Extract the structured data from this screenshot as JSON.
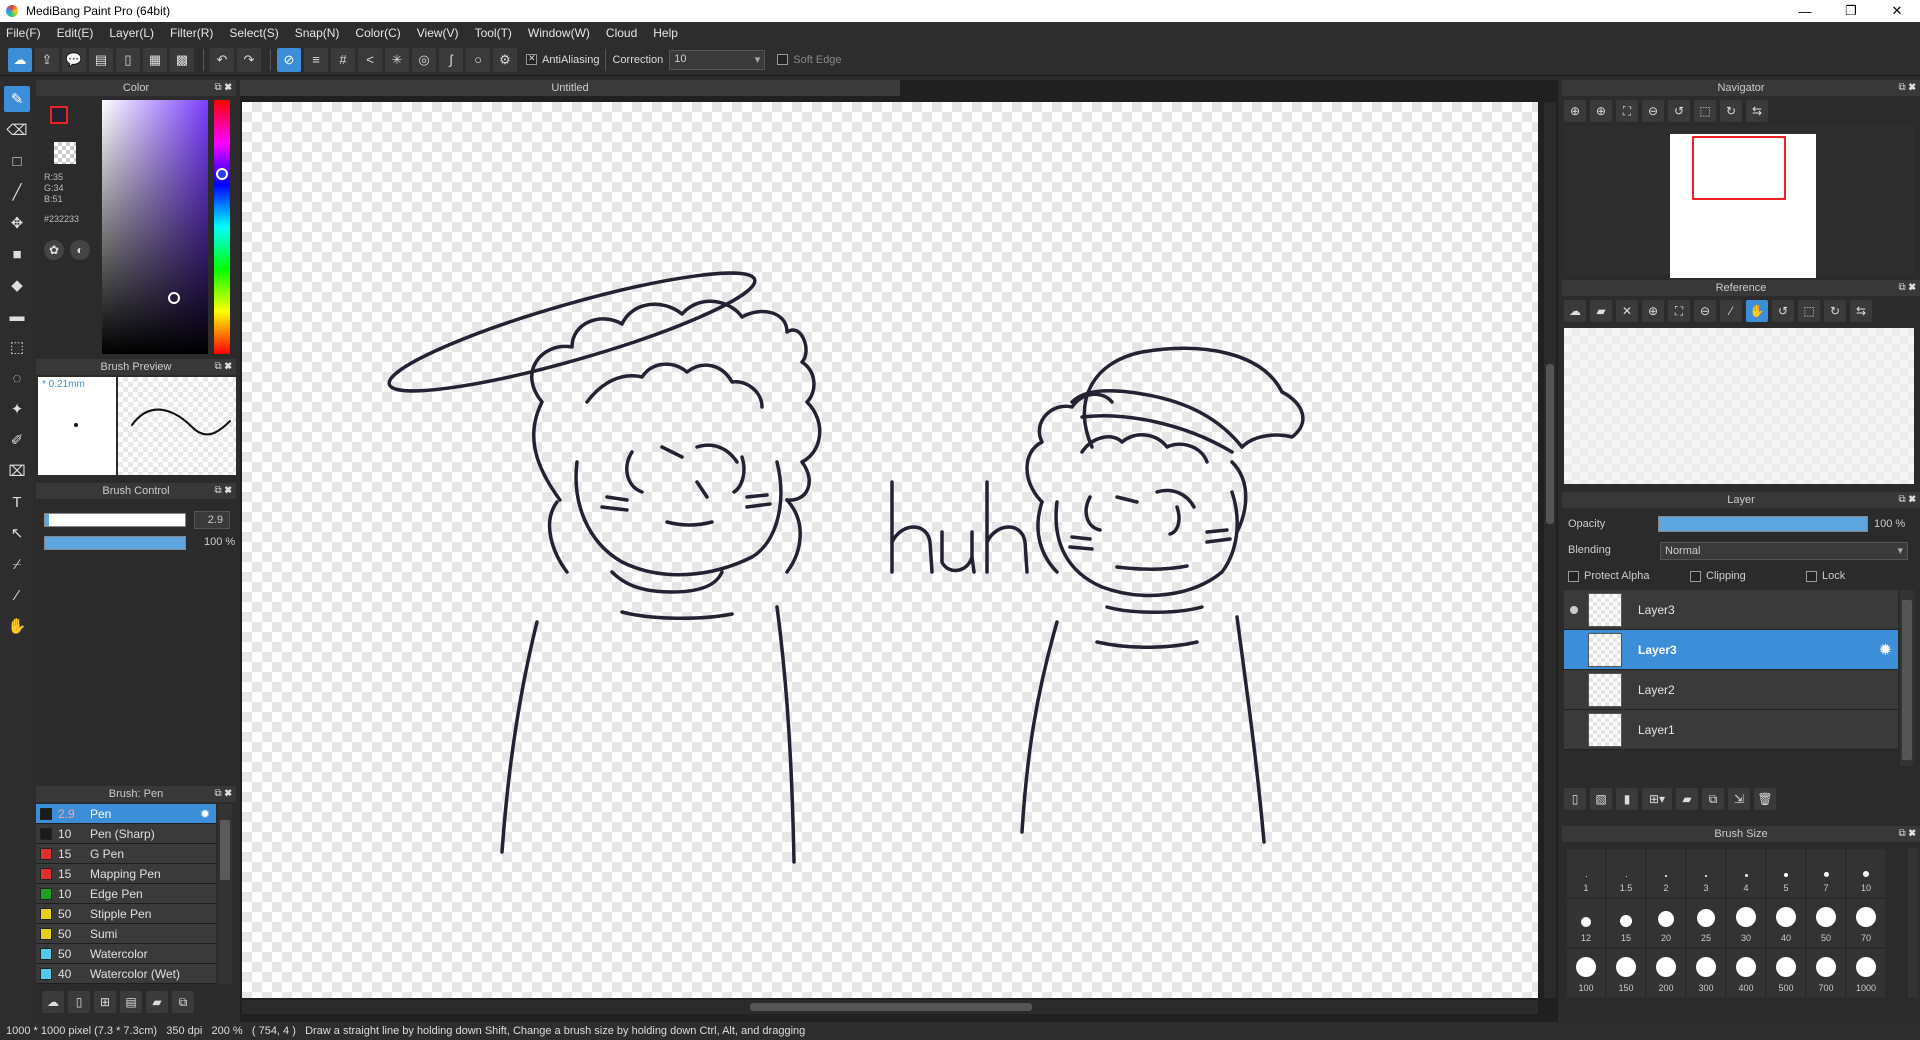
{
  "window": {
    "title": "MediBang Paint Pro (64bit)",
    "minimize": "—",
    "maximize": "❐",
    "close": "✕"
  },
  "menu": [
    "File(F)",
    "Edit(E)",
    "Layer(L)",
    "Filter(R)",
    "Select(S)",
    "Snap(N)",
    "Color(C)",
    "View(V)",
    "Tool(T)",
    "Window(W)",
    "Cloud",
    "Help"
  ],
  "toolbar": {
    "antialiasing_label": "AntiAliasing",
    "correction_label": "Correction",
    "correction_value": "10",
    "soft_edge_label": "Soft Edge"
  },
  "color_panel": {
    "title": "Color",
    "r": "R:35",
    "g": "G:34",
    "b": "B:51",
    "hex": "#232233",
    "fg_color": "#232233"
  },
  "brush_preview": {
    "title": "Brush Preview",
    "size": "* 0.21mm"
  },
  "brush_control": {
    "title": "Brush Control",
    "size_value": "2.9",
    "opacity_value": "100 %",
    "opacity_fraction": 1.0,
    "size_fraction": 0.03
  },
  "brush_panel": {
    "title": "Brush: Pen",
    "items": [
      {
        "size": "2.9",
        "name": "Pen",
        "color": "#1a1a1a",
        "active": true
      },
      {
        "size": "10",
        "name": "Pen (Sharp)",
        "color": "#1a1a1a"
      },
      {
        "size": "15",
        "name": "G Pen",
        "color": "#e03030"
      },
      {
        "size": "15",
        "name": "Mapping Pen",
        "color": "#e03030"
      },
      {
        "size": "10",
        "name": "Edge Pen",
        "color": "#20a020"
      },
      {
        "size": "50",
        "name": "Stipple Pen",
        "color": "#e8d020"
      },
      {
        "size": "50",
        "name": "Sumi",
        "color": "#e8d020"
      },
      {
        "size": "50",
        "name": "Watercolor",
        "color": "#50c8f0"
      },
      {
        "size": "40",
        "name": "Watercolor (Wet)",
        "color": "#50c8f0"
      }
    ]
  },
  "document": {
    "tab": "Untitled",
    "text": "huh"
  },
  "navigator": {
    "title": "Navigator"
  },
  "reference": {
    "title": "Reference"
  },
  "layer_panel": {
    "title": "Layer",
    "opacity_label": "Opacity",
    "opacity_value": "100 %",
    "blending_label": "Blending",
    "blending_value": "Normal",
    "protect_alpha": "Protect Alpha",
    "clipping": "Clipping",
    "lock": "Lock",
    "layers": [
      {
        "name": "Layer3",
        "visible_dot": true,
        "active": false
      },
      {
        "name": "Layer3",
        "active": true
      },
      {
        "name": "Layer2",
        "active": false
      },
      {
        "name": "Layer1",
        "active": false
      }
    ]
  },
  "brush_size": {
    "title": "Brush Size",
    "sizes": [
      "1",
      "1.5",
      "2",
      "3",
      "4",
      "5",
      "7",
      "10",
      "12",
      "15",
      "20",
      "25",
      "30",
      "40",
      "50",
      "70",
      "100",
      "150",
      "200",
      "300",
      "400",
      "500",
      "700",
      "1000"
    ]
  },
  "status": {
    "dimensions": "1000 * 1000 pixel",
    "physical": "(7.3 * 7.3cm)",
    "dpi": "350 dpi",
    "zoom": "200 %",
    "coords": "( 754, 4 )",
    "hint": "Draw a straight line by holding down Shift, Change a brush size by holding down Ctrl, Alt, and dragging"
  }
}
